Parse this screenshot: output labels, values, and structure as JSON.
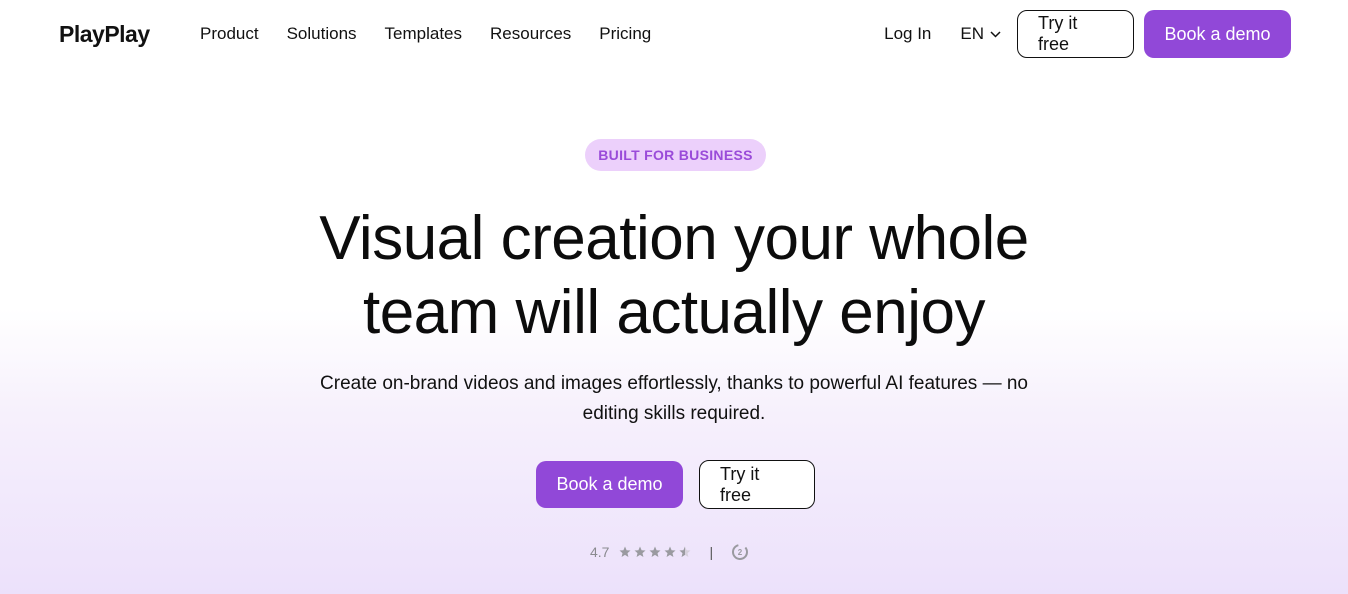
{
  "header": {
    "logo": "PlayPlay",
    "nav": [
      "Product",
      "Solutions",
      "Templates",
      "Resources",
      "Pricing"
    ],
    "login_label": "Log In",
    "language": "EN",
    "try_free_label": "Try it free",
    "book_demo_label": "Book a demo"
  },
  "hero": {
    "badge": "BUILT FOR BUSINESS",
    "headline_line1": "Visual creation your whole",
    "headline_line2": "team will actually enjoy",
    "subtitle_line1": "Create on-brand videos and images effortlessly, thanks to powerful AI features — no",
    "subtitle_line2": "editing skills required.",
    "primary_cta": "Book a demo",
    "secondary_cta": "Try it free"
  },
  "rating": {
    "score": "4.7",
    "stars_filled": 4.5,
    "stars_total": 5,
    "separator": "|",
    "review_source_icon": "g2-icon"
  },
  "colors": {
    "accent": "#9148d8",
    "badge_bg": "#ecd0fb",
    "badge_text": "#9a4bd9"
  }
}
